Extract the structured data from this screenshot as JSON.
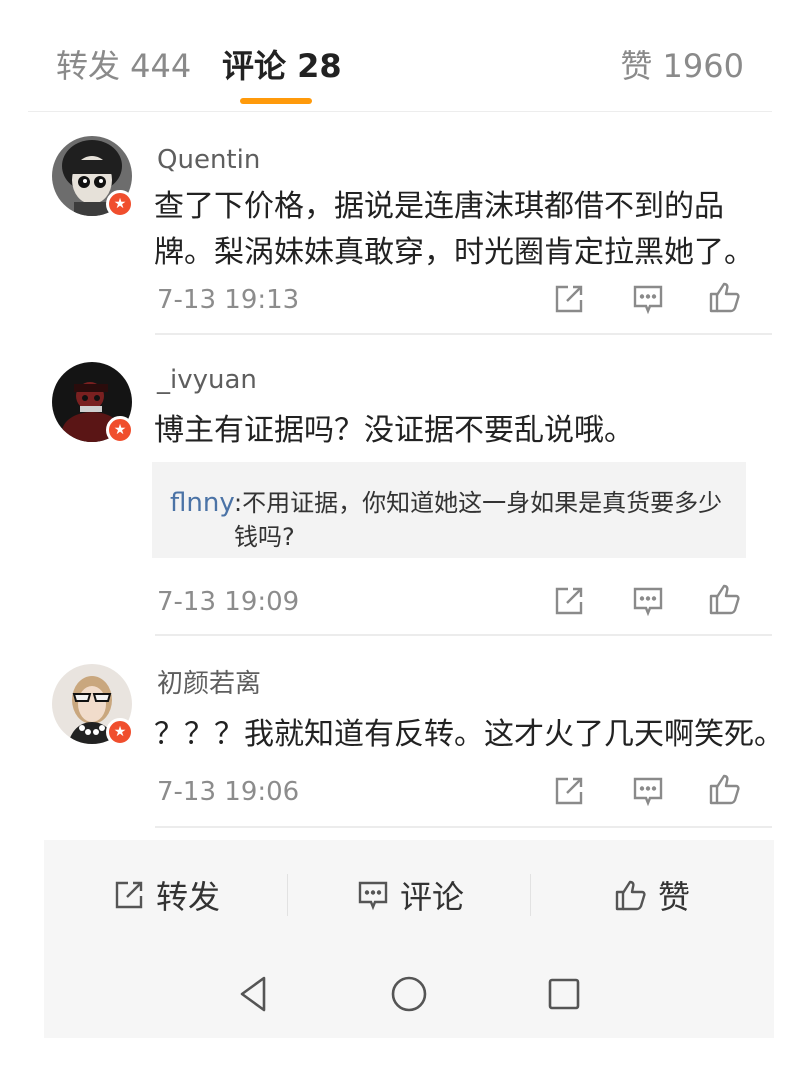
{
  "tabs": {
    "repost": "转发 444",
    "comment": "评论 28",
    "like": "赞 1960",
    "active_color": "#ff9a0b"
  },
  "comments": [
    {
      "username": "Quentin",
      "content": "查了下价格，据说是连唐沫琪都借不到的品牌。梨涡妹妹真敢穿，时光圈肯定拉黑她了。",
      "time": "7-13  19:13",
      "avatar_icon": "cartoon-girl-avatar",
      "badge_icon": "verified-badge-icon"
    },
    {
      "username": "_ivyuan",
      "content": "博主有证据吗？没证据不要乱说哦。",
      "reply": {
        "name": "flnny",
        "text": ":不用证据，你知道她这一身如果是真货要多少钱吗?"
      },
      "time": "7-13  19:09",
      "avatar_icon": "dark-photo-avatar",
      "badge_icon": "verified-badge-icon"
    },
    {
      "username": "初颜若离",
      "content": "？？？我就知道有反转。这才火了几天啊笑死。",
      "time": "7-13  19:06",
      "avatar_icon": "girl-with-sunglasses-avatar",
      "badge_icon": "verified-badge-icon"
    }
  ],
  "actionbar": {
    "repost": "转发",
    "comment": "评论",
    "like": "赞"
  },
  "colors": {
    "badge": "#f04e2d",
    "reply_name": "#4b73a6",
    "icon_gray": "#8a8a8a"
  }
}
